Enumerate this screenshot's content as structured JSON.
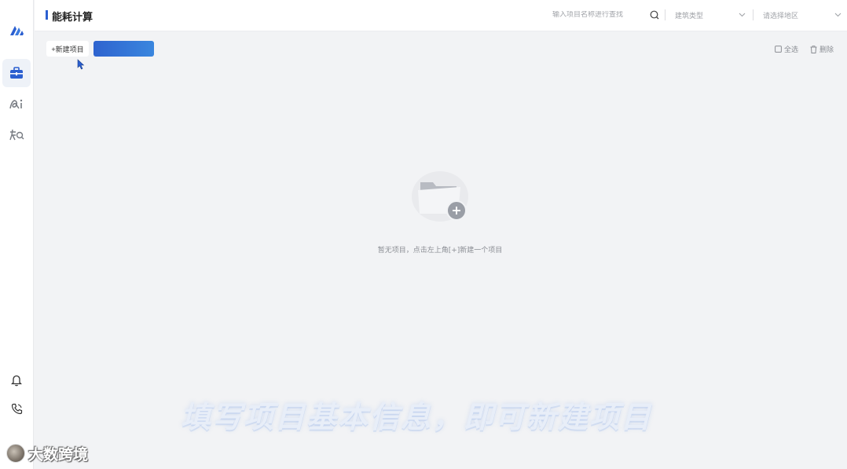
{
  "header": {
    "title": "能耗计算",
    "search_placeholder": "输入项目名称进行查找",
    "building_type_placeholder": "建筑类型",
    "region_placeholder": "请选择地区"
  },
  "toolbar": {
    "new_project_label": "+新建项目",
    "select_all_label": "全选",
    "delete_label": "删除"
  },
  "empty_state": {
    "message": "暂无项目，点击左上角[+]新建一个项目"
  },
  "overlay": {
    "caption": "填写项目基本信息，即可新建项目",
    "brand": "大数跨境"
  },
  "rail": {
    "items": [
      {
        "icon": "briefcase-icon",
        "active": true
      },
      {
        "icon": "ai-icon",
        "active": false
      },
      {
        "icon": "knowledge-icon",
        "active": false
      }
    ],
    "bottom": [
      {
        "icon": "bell-icon"
      },
      {
        "icon": "phone-icon"
      }
    ]
  },
  "colors": {
    "accent": "#2b5fd0",
    "background": "#f2f3f5"
  }
}
